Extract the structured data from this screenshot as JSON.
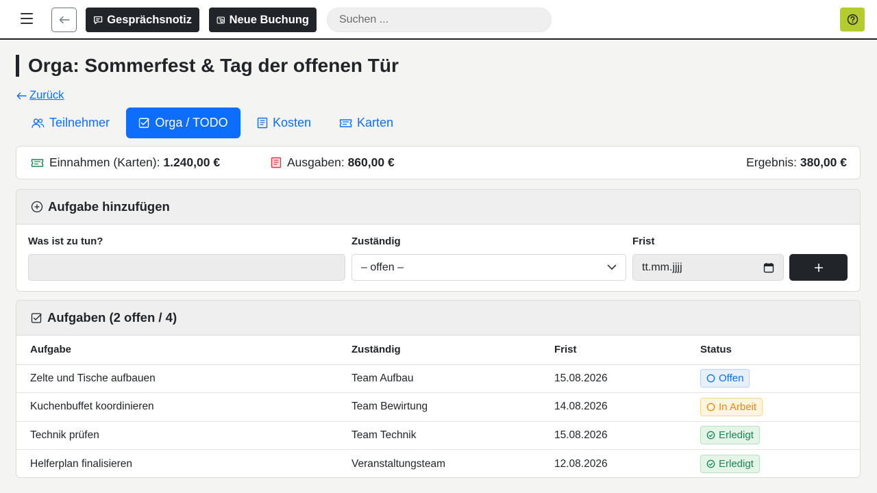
{
  "topbar": {
    "notiz_label": "Gesprächsnotiz",
    "buchung_label": "Neue Buchung",
    "search_placeholder": "Suchen ..."
  },
  "page": {
    "title": "Orga: Sommerfest & Tag der offenen Tür",
    "back_label": "Zurück"
  },
  "tabs": [
    {
      "label": "Teilnehmer",
      "icon": "users-icon"
    },
    {
      "label": "Orga / TODO",
      "icon": "checkbox-icon"
    },
    {
      "label": "Kosten",
      "icon": "receipt-icon"
    },
    {
      "label": "Karten",
      "icon": "ticket-icon"
    }
  ],
  "summary": {
    "einnahmen_label": "Einnahmen (Karten):",
    "einnahmen_value": "1.240,00 €",
    "ausgaben_label": "Ausgaben:",
    "ausgaben_value": "860,00 €",
    "ergebnis_label": "Ergebnis:",
    "ergebnis_value": "380,00 €"
  },
  "add_task": {
    "title": "Aufgabe hinzufügen",
    "task_label": "Was ist zu tun?",
    "task_value": "",
    "zustaendig_label": "Zuständig",
    "zustaendig_value": "– offen –",
    "frist_label": "Frist",
    "frist_placeholder": "tt.mm.jjjj",
    "submit_symbol": "+"
  },
  "tasks": {
    "title": "Aufgaben (2 offen / 4)",
    "columns": [
      "Aufgabe",
      "Zuständig",
      "Frist",
      "Status"
    ],
    "rows": [
      {
        "task": "Zelte und Tische aufbauen",
        "owner": "Team Aufbau",
        "due": "15.08.2026",
        "status": "Offen",
        "status_type": "offen"
      },
      {
        "task": "Kuchenbuffet koordinieren",
        "owner": "Team Bewirtung",
        "due": "14.08.2026",
        "status": "In Arbeit",
        "status_type": "inarbeit"
      },
      {
        "task": "Technik prüfen",
        "owner": "Team Technik",
        "due": "15.08.2026",
        "status": "Erledigt",
        "status_type": "erledigt"
      },
      {
        "task": "Helferplan finalisieren",
        "owner": "Veranstaltungsteam",
        "due": "12.08.2026",
        "status": "Erledigt",
        "status_type": "erledigt"
      }
    ]
  },
  "colors": {
    "accent": "#0d6efd",
    "dark": "#212529",
    "help": "#b5cc2e"
  }
}
